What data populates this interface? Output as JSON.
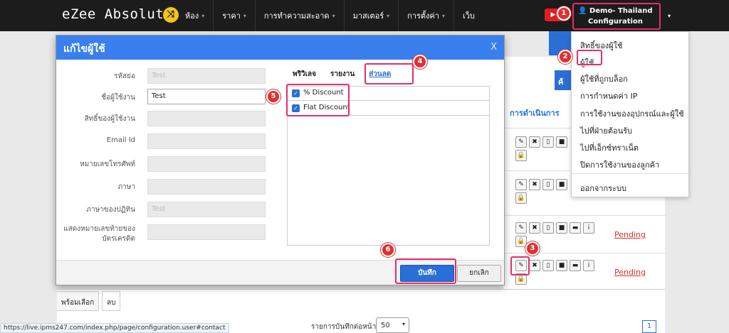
{
  "app": {
    "logo": "eZee Absolute",
    "logo_badge_glyph": "⤨"
  },
  "nav": [
    {
      "label": "ห้อง"
    },
    {
      "label": "ราคา"
    },
    {
      "label": "การทำความสะอาด"
    },
    {
      "label": "มาสเตอร์"
    },
    {
      "label": "การตั้งค่า"
    },
    {
      "label": "เว็บ"
    }
  ],
  "user": {
    "name": "Demo- Thailand",
    "section": "Configuration"
  },
  "dropdown": [
    "สิทธิ์ของผู้ใช้",
    "ผู้ใช้",
    "ผู้ใช้ที่ถูกบล็อก",
    "การกำหนดค่า IP",
    "การใช้งานของอุปกรณ์และผู้ใช้",
    "ไปที่ฝ่ายต้อนรับ",
    "ไปที่เอ็กซ์ทราเน็ต",
    "ปิดการใช้งานของลูกค้า",
    "ออกจากระบบ"
  ],
  "callouts": [
    "1",
    "2",
    "3",
    "4",
    "5",
    "6"
  ],
  "background": {
    "blue_button_label": "ค้",
    "actions_header": "การดำเนินการ",
    "pending": "Pending",
    "footer_tabs": [
      "พร้อมเลือก",
      "ลบ"
    ],
    "per_page_label": "รายการบันทึกต่อหน้า",
    "per_page_value": "50",
    "page_number": "1",
    "status_url": "https://live.ipms247.com/index.php/page/configuration.user#contact"
  },
  "modal": {
    "title": "แก้ไขผู้ใช้",
    "close": "X",
    "fields": [
      {
        "label": "รหัสย่อ",
        "value": "Test",
        "live": false
      },
      {
        "label": "ชื่อผู้ใช้งาน",
        "value": "Test",
        "live": true
      },
      {
        "label": "สิทธิ์ของผู้ใช้งาน",
        "value": "",
        "live": false
      },
      {
        "label": "Email Id",
        "value": "",
        "live": false
      },
      {
        "label": "หมายเลขโทรศัพท์",
        "value": "",
        "live": false
      },
      {
        "label": "ภาษา",
        "value": "",
        "live": false
      },
      {
        "label": "ภาษาของปฏิทิน",
        "value": "Test",
        "live": false
      },
      {
        "label": "แสดงหมายเลขท้ายของ",
        "value": "",
        "live": false
      },
      {
        "label": "บัตรเครดิต",
        "value": "",
        "live": false
      }
    ],
    "tabs": [
      {
        "label": "พริวิเลจ",
        "active": false
      },
      {
        "label": "รายงาน",
        "active": false
      },
      {
        "label": "ส่วนลด",
        "active": true
      }
    ],
    "permissions": [
      {
        "label": "% Discount",
        "checked": true
      },
      {
        "label": "Flat Discount",
        "checked": true
      }
    ],
    "save_label": "บันทึก",
    "cancel_label": "ยกเลิก"
  },
  "colors": {
    "accent": "#2a6fd6",
    "highlight": "#e62e68",
    "callout": "#e03030",
    "pending": "#d9322b"
  },
  "icons": [
    "chevron-down-icon",
    "youtube-icon",
    "user-icon",
    "pencil-icon",
    "close-icon",
    "mobile-icon",
    "lock-icon",
    "chat-icon",
    "info-icon",
    "checkbox-icon"
  ]
}
